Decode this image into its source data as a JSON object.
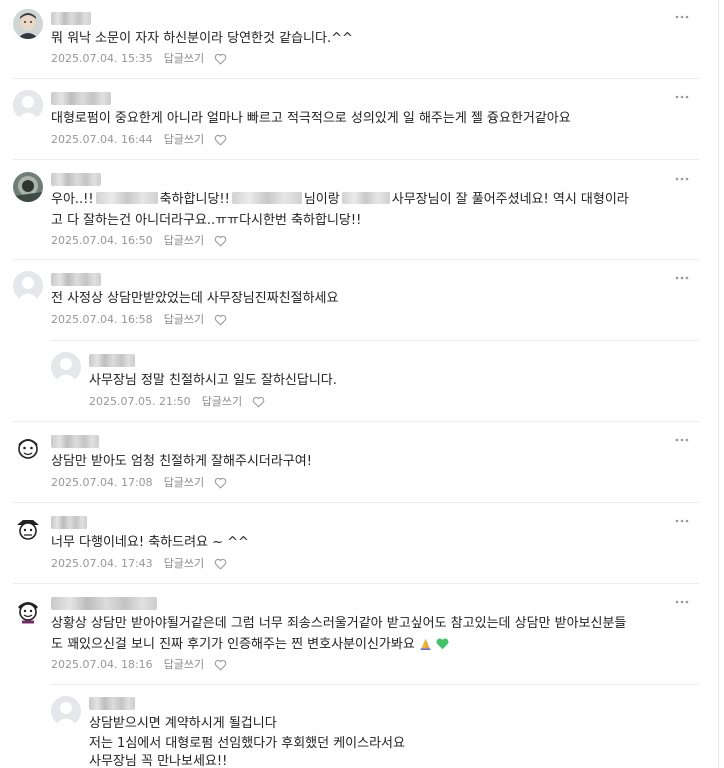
{
  "comment_section": {
    "reply_label": "답글쓰기",
    "comments": [
      {
        "author": "",
        "avatar_icon": "profile-photo",
        "lines": [
          "뭐 워낙 소문이 자자 하신분이라 당연한것 같습니다.^^"
        ],
        "date": "2025.07.04. 15:35"
      },
      {
        "author": "",
        "avatar_icon": "default-avatar",
        "lines": [
          "대형로펌이 중요한게 아니라 얼마나 빠르고 적극적으로 성의있게 일 해주는게 젤 즁요한거같아요"
        ],
        "date": "2025.07.04. 16:44"
      },
      {
        "author": "",
        "avatar_icon": "profile-photo",
        "lines": {
          "l1_a": "우아..!!",
          "l1_b": "축하합니당!!",
          "l1_c": "님이랑",
          "l1_d": "사무장님이 잘 풀어주셨네요! 역시 대형이라",
          "l2": "고 다 잘하는건 아니더라구요..ㅠㅠ다시한번 축하합니당!!"
        },
        "date": "2025.07.04. 16:50"
      },
      {
        "author": "",
        "avatar_icon": "default-avatar",
        "lines": [
          "전 사정상 상담만받았었는데 사무장님진짜친절하세요"
        ],
        "date": "2025.07.04. 16:58"
      },
      {
        "author": "",
        "avatar_icon": "default-avatar",
        "is_reply": true,
        "lines": [
          "사무장님 정말 친절하시고 일도 잘하신답니다."
        ],
        "date": "2025.07.05. 21:50"
      },
      {
        "author": "",
        "avatar_icon": "cartoon-avatar",
        "lines": [
          "상담만 받아도 엄청 친절하게 잘해주시더라구여!"
        ],
        "date": "2025.07.04. 17:08"
      },
      {
        "author": "",
        "avatar_icon": "cartoon-avatar",
        "lines": [
          "너무 다행이네요! 축하드려요 ~ ^^"
        ],
        "date": "2025.07.04. 17:43"
      },
      {
        "author": "",
        "avatar_icon": "cartoon-avatar",
        "lines": [
          "상황상 상담만 받아야될거같은데 그럼 너무 죄송스러울거같아 받고싶어도 참고있는데 상담만 받아보신분들",
          "도 꽤있으신걸 보니 진짜 후기가 인증해주는 찐 변호사분이신가봐요"
        ],
        "emojis": [
          "folded-hands-emoji",
          "green-heart-emoji"
        ],
        "date": "2025.07.04. 18:16"
      },
      {
        "author": "",
        "avatar_icon": "default-avatar",
        "is_reply": true,
        "lines": [
          "상담받으시면 계약하시게 될겁니다",
          "저는 1심에서 대형로펌 선임했다가 후회했던 케이스라서요",
          "사무장님 꼭 만나보세요!!"
        ],
        "date": ""
      }
    ]
  }
}
